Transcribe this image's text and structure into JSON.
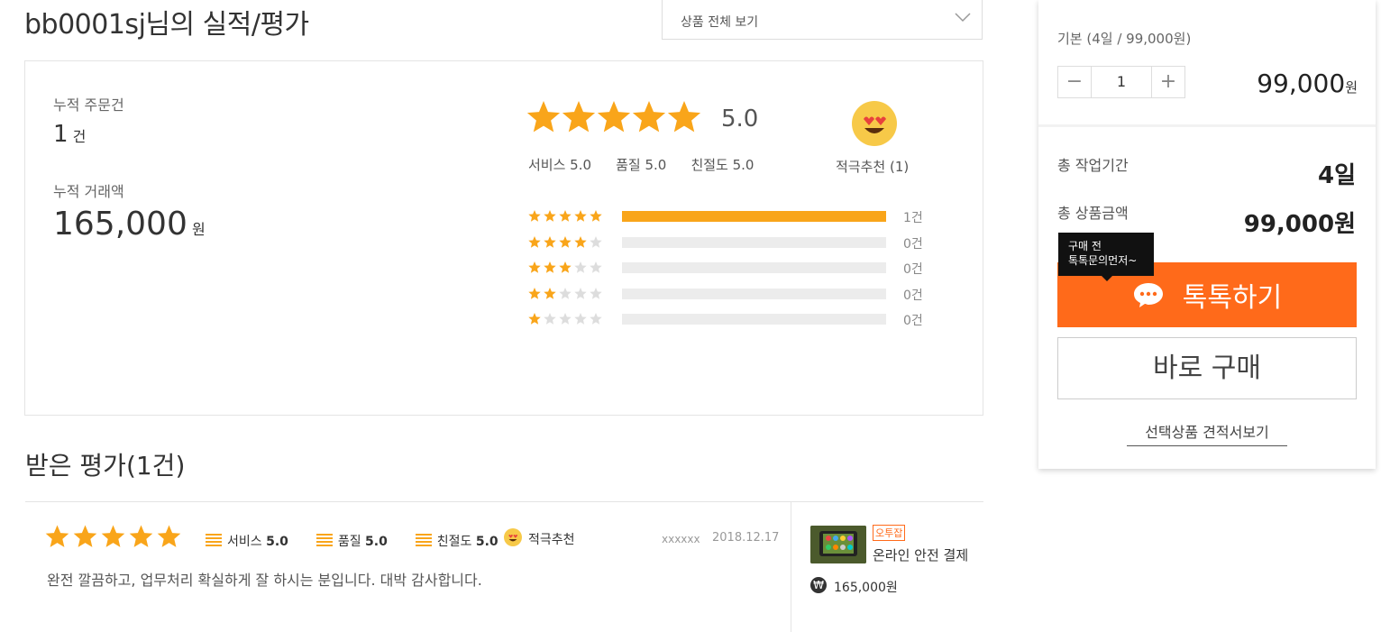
{
  "header": {
    "title": "bb0001sj님의 실적/평가",
    "filter_label": "상품 전체 보기"
  },
  "summary": {
    "orders_label": "누적 주문건",
    "orders_value": "1",
    "orders_unit": "건",
    "amount_label": "누적 거래액",
    "amount_value": "165,000",
    "amount_unit": "원",
    "rating_score": "5.0",
    "rating_stars": 5,
    "sub_scores": {
      "service": "서비스 5.0",
      "quality": "품질 5.0",
      "kindness": "친절도 5.0"
    },
    "recommend_label": "적극추천 (1)",
    "distribution": [
      {
        "stars": 5,
        "fraction": 1.0,
        "count": "1건"
      },
      {
        "stars": 4,
        "fraction": 0.0,
        "count": "0건"
      },
      {
        "stars": 3,
        "fraction": 0.0,
        "count": "0건"
      },
      {
        "stars": 2,
        "fraction": 0.0,
        "count": "0건"
      },
      {
        "stars": 1,
        "fraction": 0.0,
        "count": "0건"
      }
    ]
  },
  "reviews": {
    "title": "받은 평가(1건)",
    "items": [
      {
        "stars": 5,
        "service_label": "서비스",
        "service_score": "5.0",
        "quality_label": "품질",
        "quality_score": "5.0",
        "kindness_label": "친절도",
        "kindness_score": "5.0",
        "recommend": "적극추천",
        "user": "xxxxxx",
        "date": "2018.12.17",
        "text": "완전 깔끔하고, 업무처리 확실하게 잘 하시는 분입니다. 대박 감사합니다.",
        "product_badge": "오투잡",
        "product_name": "온라인 안전 결제",
        "product_price": "165,000원"
      }
    ]
  },
  "order_panel": {
    "option_label": "기본 (4일 / 99,000원)",
    "quantity": "1",
    "minus": "−",
    "plus": "+",
    "price": "99,000",
    "price_unit": "원",
    "period_label": "총 작업기간",
    "period_value": "4일",
    "total_label": "총 상품금액",
    "total_value": "99,000원",
    "tooltip_line1": "구매 전",
    "tooltip_line2": "톡톡문의먼저~",
    "talk_button": "톡톡하기",
    "buy_button": "바로 구매",
    "quote_link": "선택상품 견적서보기"
  },
  "colors": {
    "accent": "#ff6a1a",
    "star": "#f9a51a"
  }
}
